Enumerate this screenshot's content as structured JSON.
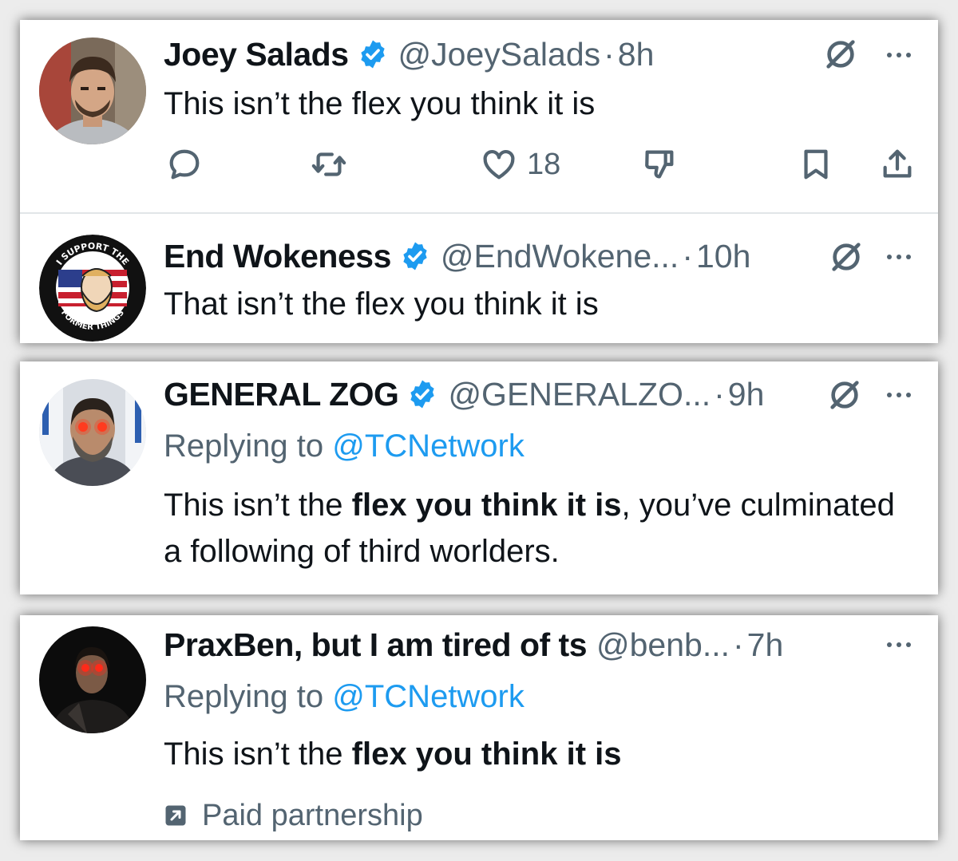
{
  "tweets": [
    {
      "name": "Joey Salads",
      "verified": true,
      "handle": "@JoeySalads",
      "separator": "·",
      "time": "8h",
      "text": "This isn’t the flex you think it is",
      "likes": "18"
    },
    {
      "name": "End Wokeness",
      "verified": true,
      "handle": "@EndWokene...",
      "separator": "·",
      "time": "10h",
      "text": "That isn’t the flex you think it is",
      "avatar_text_top": "I SUPPORT THE",
      "avatar_text_bottom": "FORMER THINGS"
    },
    {
      "name": "GENERAL ZOG",
      "verified": true,
      "handle": "@GENERALZO...",
      "separator": "·",
      "time": "9h",
      "replying_prefix": "Replying to",
      "replying_to": "@TCNetwork",
      "text_pre": "This isn’t the ",
      "text_bold": "flex you think it is",
      "text_post": ", you’ve culminated a following of third worlders."
    },
    {
      "name": "PraxBen, but I am tired of ts",
      "verified": false,
      "handle": "@benb...",
      "separator": "·",
      "time": "7h",
      "replying_prefix": "Replying to",
      "replying_to": "@TCNetwork",
      "text_pre": "This isn’t the ",
      "text_bold": "flex you think it is",
      "paid_label": "Paid partnership"
    }
  ],
  "icons": {
    "reply": "reply-icon",
    "retweet": "retweet-icon",
    "like": "heart-icon",
    "dislike": "dislike-icon",
    "bookmark": "bookmark-icon",
    "share": "share-icon",
    "grok": "grok-icon",
    "more": "more-icon",
    "verified": "verified-badge-icon"
  },
  "colors": {
    "verified": "#1d9bf0",
    "link": "#1d9bf0",
    "muted": "#536471",
    "text": "#0f1419"
  }
}
